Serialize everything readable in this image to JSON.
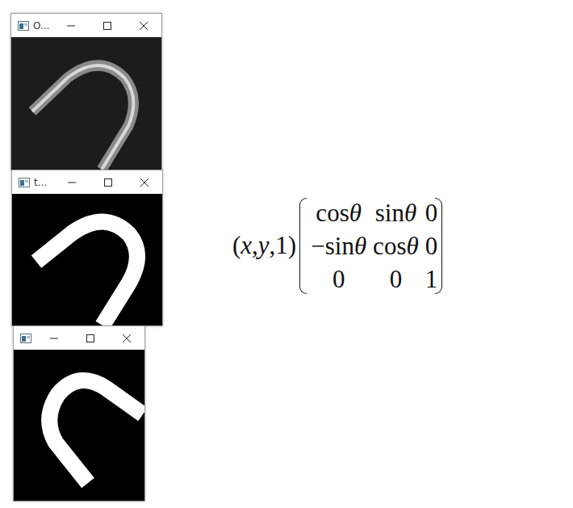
{
  "windows": [
    {
      "title": "O...",
      "kind": "photo"
    },
    {
      "title": "t...",
      "kind": "mask"
    },
    {
      "title": "",
      "kind": "mask-rotated"
    }
  ],
  "formula": {
    "vector": "(x,y,1)",
    "matrix": [
      [
        "cosθ",
        "sinθ",
        "0"
      ],
      [
        "−sinθ",
        "cosθ",
        "0"
      ],
      [
        "0",
        "0",
        "1"
      ]
    ]
  }
}
